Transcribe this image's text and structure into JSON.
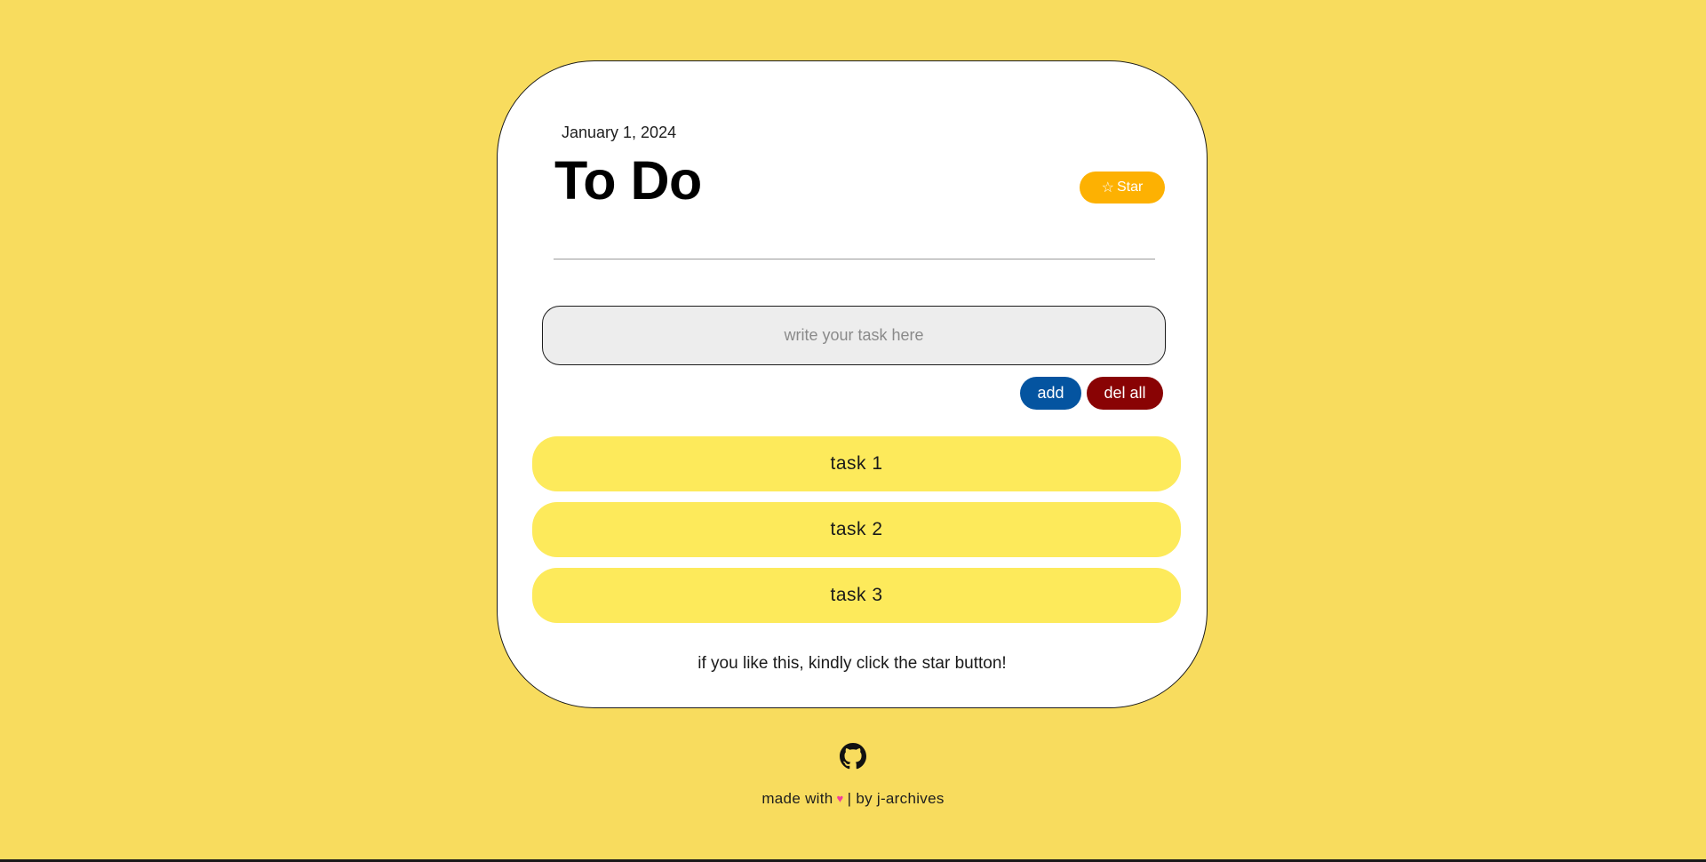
{
  "header": {
    "date": "January 1, 2024",
    "title": "To Do",
    "star_label": "Star",
    "star_icon": "☆"
  },
  "input": {
    "placeholder": "write your task here",
    "value": ""
  },
  "actions": {
    "add_label": "add",
    "delete_all_label": "del all"
  },
  "tasks": [
    {
      "label": "task 1"
    },
    {
      "label": "task 2"
    },
    {
      "label": "task 3"
    }
  ],
  "note": "if you like this, kindly click the star button!",
  "footer": {
    "made_with": "made with",
    "heart_icon": "heart-icon",
    "separator": "|",
    "by": "by j-archives",
    "github_icon": "github-icon"
  },
  "colors": {
    "background": "#f8dc5e",
    "card": "#ffffff",
    "star_button": "#fdb102",
    "add_button": "#0454a0",
    "delete_all_button": "#890304",
    "task_item": "#fdea5b",
    "input_background": "#ededed"
  }
}
